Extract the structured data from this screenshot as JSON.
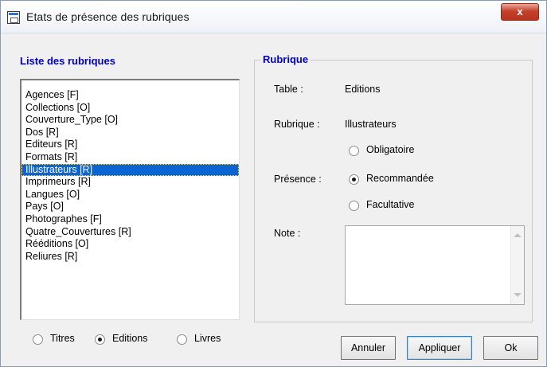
{
  "window": {
    "title": "Etats de présence des rubriques",
    "close_label": "x"
  },
  "list_section": {
    "heading": "Liste des rubriques",
    "items": [
      "Agences [F]",
      "Collections [O]",
      "Couverture_Type [O]",
      "Dos [R]",
      "Editeurs [R]",
      "Formats [R]",
      "Illustrateurs [R]",
      "Imprimeurs [R]",
      "Langues [O]",
      "Pays [O]",
      "Photographes [F]",
      "Quatre_Couvertures [R]",
      "Rééditions [O]",
      "Reliures [R]"
    ],
    "selected_index": 6
  },
  "scope_options": {
    "options": [
      "Titres",
      "Editions",
      "Livres"
    ],
    "selected": "Editions"
  },
  "rubrique": {
    "legend": "Rubrique",
    "table_label": "Table :",
    "table_value": "Editions",
    "rubrique_label": "Rubrique :",
    "rubrique_value": "Illustrateurs",
    "presence_label": "Présence :",
    "presence_options": [
      "Obligatoire",
      "Recommandée",
      "Facultative"
    ],
    "presence_selected": "Recommandée",
    "note_label": "Note :",
    "note_value": ""
  },
  "buttons": {
    "cancel": "Annuler",
    "apply": "Appliquer",
    "ok": "Ok"
  },
  "colors": {
    "heading_blue": "#0000c8",
    "selection_blue": "#0a64d4",
    "close_red": "#c7402a"
  }
}
